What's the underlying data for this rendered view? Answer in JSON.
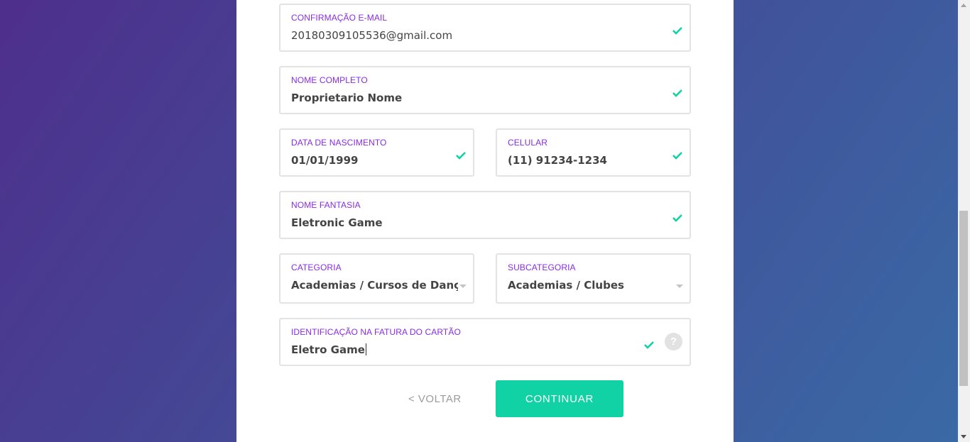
{
  "form": {
    "email_confirm": {
      "label": "CONFIRMAÇÃO E-MAIL",
      "value": "20180309105536@gmail.com",
      "valid": true
    },
    "full_name": {
      "label": "NOME COMPLETO",
      "value": "Proprietario Nome",
      "valid": true
    },
    "birth_date": {
      "label": "DATA DE NASCIMENTO",
      "value": "01/01/1999",
      "valid": true
    },
    "mobile": {
      "label": "CELULAR",
      "value": "(11) 91234-1234",
      "valid": true
    },
    "trade_name": {
      "label": "NOME FANTASIA",
      "value": "Eletronic Game",
      "valid": true
    },
    "category": {
      "label": "CATEGORIA",
      "selected": "Academias / Cursos de Dança / Esco"
    },
    "subcategory": {
      "label": "SUBCATEGORIA",
      "selected": "Academias / Clubes"
    },
    "card_statement_id": {
      "label": "IDENTIFICAÇÃO NA FATURA DO CARTÃO",
      "value": "Eletro Game",
      "valid": true,
      "help": "?"
    }
  },
  "actions": {
    "back_label": "< VOLTAR",
    "continue_label": "CONTINUAR"
  },
  "icons": {
    "valid": "check-icon",
    "dropdown": "caret-down-icon",
    "help": "question-icon"
  },
  "colors": {
    "label": "#8a2be2",
    "check": "#10d2a5",
    "primary_button": "#10d2a5",
    "value_text": "#444444",
    "link": "#9c9c9c"
  }
}
